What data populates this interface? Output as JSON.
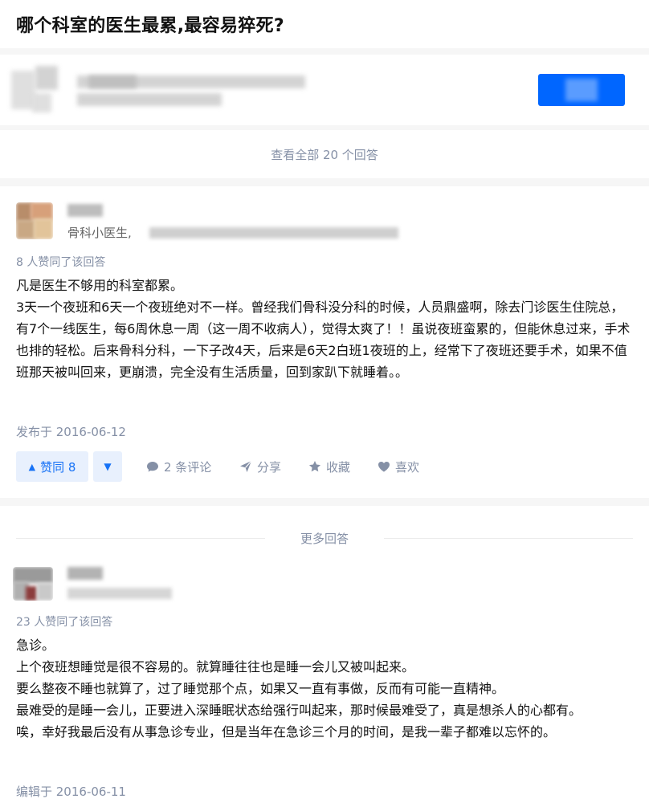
{
  "question": {
    "title": "哪个科室的医生最累,最容易猝死?"
  },
  "view_all": {
    "label": "查看全部 20 个回答"
  },
  "answer1": {
    "author_headline": "骨科小医生,",
    "vote_summary": "8 人赞同了该回答",
    "paragraphs": [
      "凡是医生不够用的科室都累。",
      "3天一个夜班和6天一个夜班绝对不一样。曾经我们骨科没分科的时候，人员鼎盛啊，除去门诊医生住院总，有7个一线医生，每6周休息一周（这一周不收病人），觉得太爽了！！虽说夜班蛮累的，但能休息过来，手术也排的轻松。后来骨科分科，一下子改4天，后来是6天2白班1夜班的上，经常下了夜班还要手术，如果不值班那天被叫回来，更崩溃，完全没有生活质量，回到家趴下就睡着。。"
    ],
    "published": "发布于 2016-06-12",
    "actions": {
      "upvote": "赞同 8",
      "comments": "2 条评论",
      "share": "分享",
      "collect": "收藏",
      "like": "喜欢"
    }
  },
  "more_answers": {
    "label": "更多回答"
  },
  "answer2": {
    "vote_summary": "23 人赞同了该回答",
    "paragraphs": [
      "急诊。",
      "上个夜班想睡觉是很不容易的。就算睡往往也是睡一会儿又被叫起来。",
      "要么整夜不睡也就算了，过了睡觉那个点，如果又一直有事做，反而有可能一直精神。",
      "最难受的是睡一会儿，正要进入深睡眠状态给强行叫起来，那时候最难受了，真是想杀人的心都有。",
      "唉，幸好我最后没有从事急诊专业，但是当年在急诊三个月的时间，是我一辈子都难以忘怀的。"
    ],
    "edited": "编辑于 2016-06-11"
  },
  "icons": {
    "upvote": "triangle-up-icon",
    "downvote": "triangle-down-icon",
    "comment": "comment-bubble-icon",
    "share": "paper-plane-icon",
    "collect": "star-icon",
    "like": "heart-icon"
  },
  "colors": {
    "accent": "#1772f6",
    "promo_button": "#0066ff",
    "meta_text": "#8590a6",
    "vote_bg": "#e8f0fd"
  }
}
